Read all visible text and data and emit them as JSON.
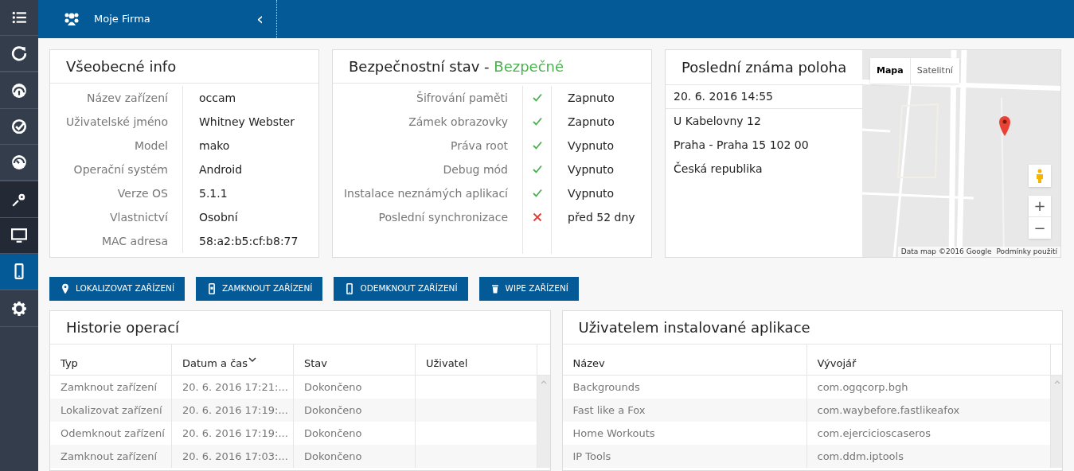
{
  "sidebar": {
    "items": [
      {
        "selected": false
      },
      {
        "selected": false
      },
      {
        "selected": false
      },
      {
        "selected": false
      },
      {
        "selected": false
      },
      {
        "selected": false
      },
      {
        "selected": false
      },
      {
        "selected": true
      },
      {
        "selected": false
      }
    ]
  },
  "topbar": {
    "company": "Moje Firma",
    "collapse": "‹"
  },
  "general_info": {
    "title": "Všeobecné info",
    "rows": [
      {
        "label": "Název zařízení",
        "value": "occam"
      },
      {
        "label": "Uživatelské jméno",
        "value": "Whitney Webster"
      },
      {
        "label": "Model",
        "value": "mako"
      },
      {
        "label": "Operační systém",
        "value": "Android"
      },
      {
        "label": "Verze OS",
        "value": "5.1.1"
      },
      {
        "label": "Vlastnictví",
        "value": "Osobní"
      },
      {
        "label": "MAC adresa",
        "value": "58:a2:b5:cf:b8:77"
      }
    ]
  },
  "security": {
    "title": "Bezpečnostní stav - ",
    "status": "Bezpečné",
    "rows": [
      {
        "label": "Šifrování paměti",
        "ok": true,
        "value": "Zapnuto"
      },
      {
        "label": "Zámek obrazovky",
        "ok": true,
        "value": "Zapnuto"
      },
      {
        "label": "Práva root",
        "ok": true,
        "value": "Vypnuto"
      },
      {
        "label": "Debug mód",
        "ok": true,
        "value": "Vypnuto"
      },
      {
        "label": "Instalace neznámých aplikací",
        "ok": true,
        "value": "Vypnuto"
      },
      {
        "label": "Poslední synchronizace",
        "ok": false,
        "value": "před 52 dny"
      }
    ]
  },
  "location": {
    "title": "Poslední známa poloha",
    "time": "20. 6. 2016 14:55",
    "address": [
      "U Kabelovny 12",
      "Praha - Praha 15 102 00",
      "Česká republika"
    ],
    "map": {
      "kind": "picture",
      "types": [
        {
          "label": "Mapa",
          "selected": true
        },
        {
          "label": "Satelitní",
          "selected": false
        }
      ],
      "zoom_in": "+",
      "zoom_out": "−",
      "attribution": "Data map ©2016 Google",
      "terms": "Podmínky použití"
    }
  },
  "actions": [
    {
      "label": "LOKALIZOVAT ZAŘÍZENÍ"
    },
    {
      "label": "ZAMKNOUT ZAŘÍZENÍ"
    },
    {
      "label": "ODEMKNOUT ZAŘÍZENÍ"
    },
    {
      "label": "WIPE ZAŘÍZENÍ"
    }
  ],
  "history": {
    "title": "Historie operací",
    "columns": [
      {
        "label": "Typ",
        "sorted": false
      },
      {
        "label": "Datum a čas",
        "sorted": true
      },
      {
        "label": "Stav",
        "sorted": false
      },
      {
        "label": "Uživatel",
        "sorted": false
      }
    ],
    "rows": [
      [
        "Zamknout zařízení",
        "20. 6. 2016 17:21:...",
        "Dokončeno",
        ""
      ],
      [
        "Lokalizovat zařízení",
        "20. 6. 2016 17:19:...",
        "Dokončeno",
        ""
      ],
      [
        "Odemknout zařízení",
        "20. 6. 2016 17:19:...",
        "Dokončeno",
        ""
      ],
      [
        "Zamknout zařízení",
        "20. 6. 2016 17:03:...",
        "Dokončeno",
        ""
      ]
    ]
  },
  "apps": {
    "title": "Uživatelem instalované aplikace",
    "columns": [
      {
        "label": "Název",
        "sorted": false
      },
      {
        "label": "Vývojář",
        "sorted": false
      }
    ],
    "rows": [
      [
        "Backgrounds",
        "com.ogqcorp.bgh"
      ],
      [
        "Fast like a Fox",
        "com.waybefore.fastlikeafox"
      ],
      [
        "Home Workouts",
        "com.ejercicioscaseros"
      ],
      [
        "IP Tools",
        "com.ddm.iptools"
      ]
    ]
  }
}
